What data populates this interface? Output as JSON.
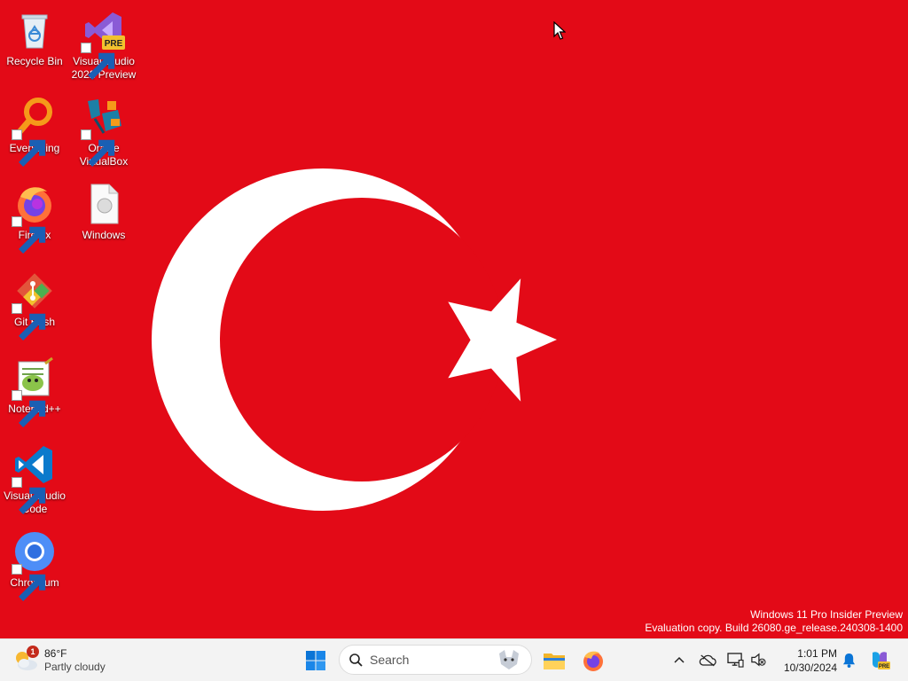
{
  "desktop": {
    "icons": [
      {
        "label": "Recycle Bin",
        "icon": "recycle-bin-icon"
      },
      {
        "label": "Visual Studio 2022 Preview",
        "icon": "visual-studio-preview-icon",
        "badge": "PRE"
      },
      {
        "label": "Everything",
        "icon": "everything-search-icon"
      },
      {
        "label": "Oracle VirtualBox",
        "icon": "virtualbox-icon"
      },
      {
        "label": "Firefox",
        "icon": "firefox-icon"
      },
      {
        "label": "Windows",
        "icon": "file-icon"
      },
      {
        "label": "Git Bash",
        "icon": "git-bash-icon"
      },
      {
        "label": "Notepad++",
        "icon": "notepad-plus-plus-icon"
      },
      {
        "label": "Visual Studio Code",
        "icon": "vscode-icon"
      },
      {
        "label": "Chromium",
        "icon": "chromium-icon"
      }
    ],
    "wallpaper": "turkish-flag",
    "wallpaper_colors": {
      "red": "#e30a17",
      "white": "#ffffff"
    }
  },
  "watermark": {
    "line1": "Windows 11 Pro Insider Preview",
    "line2": "Evaluation copy. Build 26080.ge_release.240308-1400"
  },
  "taskbar": {
    "weather": {
      "temp": "86°F",
      "condition": "Partly cloudy",
      "badge": "1"
    },
    "search": {
      "placeholder": "Search"
    },
    "pinned": [
      "start-icon",
      "file-explorer-icon",
      "firefox-icon"
    ],
    "tray": [
      "chevron-up-icon",
      "onedrive-icon",
      "network-icon",
      "volume-mute-icon",
      "notification-bell-icon",
      "copilot-icon"
    ],
    "clock": {
      "time": "1:01 PM",
      "date": "10/30/2024"
    },
    "copilot_badge": "PRE"
  }
}
